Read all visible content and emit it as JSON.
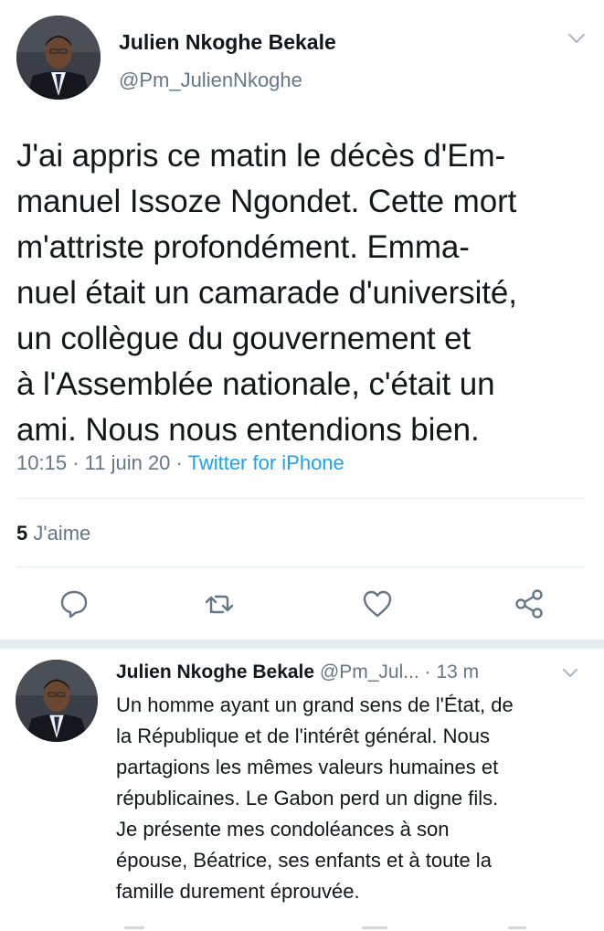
{
  "main_tweet": {
    "author_name": "Julien Nkoghe Bekale",
    "author_handle": "@Pm_JulienNkoghe",
    "text_lines": [
      "J'ai appris ce matin le décès d'Em-",
      "manuel Issoze Ngondet. Cette mort",
      "m'attriste profondément. Emma-",
      "nuel était un camarade d'université,",
      "un collègue du gouvernement et",
      "à l'Assemblée nationale, c'était un",
      "ami. Nous nous entendions bien."
    ],
    "time": "10:15",
    "date": "11 juin 20",
    "source": "Twitter for iPhone",
    "separator": "·",
    "likes_count": "5",
    "likes_label": "J'aime",
    "actions": [
      "reply-icon",
      "retweet-icon",
      "like-icon",
      "share-icon"
    ]
  },
  "reply_tweet": {
    "author_name": "Julien Nkoghe Bekale",
    "author_handle": "@Pm_Jul...",
    "separator": "·",
    "time_ago": "13 m",
    "text_lines": [
      "Un homme ayant un grand sens de l'État, de",
      "la République et de l'intérêt général. Nous",
      "partagions les mêmes valeurs humaines et",
      "républicaines. Le Gabon perd un digne fils.",
      "Je présente mes condoléances à son",
      "épouse, Béatrice, ses enfants et à toute la",
      "famille durement éprouvée."
    ]
  },
  "colors": {
    "text": "#14171a",
    "muted": "#657786",
    "link": "#1da1f2",
    "divider": "#e6ecf0"
  }
}
